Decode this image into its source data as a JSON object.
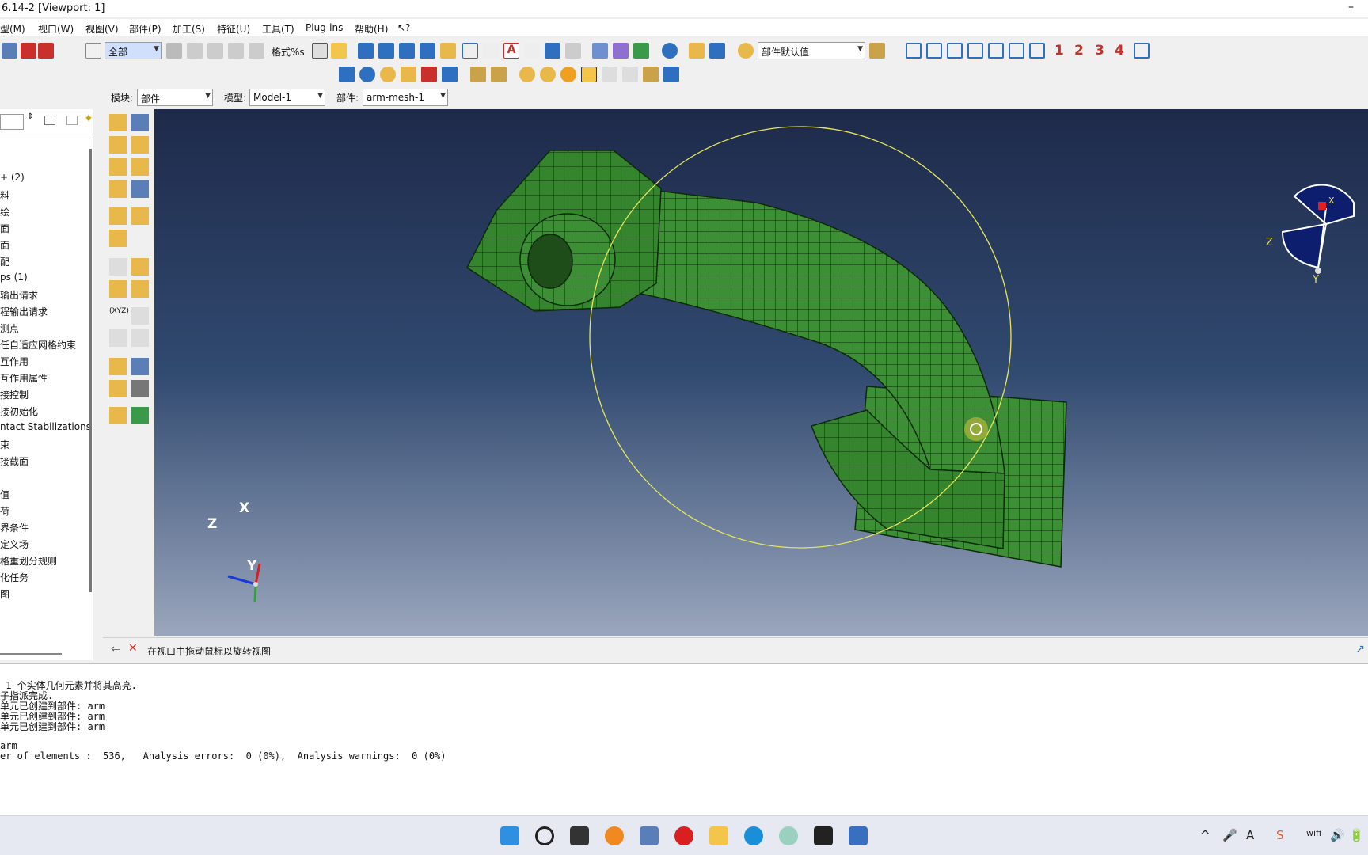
{
  "window": {
    "title": "6.14-2 [Viewport: 1]",
    "minimize": "–"
  },
  "menu": [
    "型(M)",
    "视口(W)",
    "视图(V)",
    "部件(P)",
    "加工(S)",
    "特征(U)",
    "工具(T)",
    "Plug-ins",
    "帮助(H)",
    "↖?"
  ],
  "toolbar": {
    "selection_filter": "全部",
    "format_text": "格式%s",
    "render_style": "部件默认值",
    "view_numbers": [
      "1",
      "2",
      "3",
      "4"
    ]
  },
  "context": {
    "module_label": "模块:",
    "module_value": "部件",
    "model_label": "模型:",
    "model_value": "Model-1",
    "part_label": "部件:",
    "part_value": "arm-mesh-1"
  },
  "tree_items": [
    "+ (2)",
    "料",
    "绘",
    "面",
    "面",
    "配",
    "ps (1)",
    "输出请求",
    "程输出请求",
    "测点",
    "任自适应网格约束",
    "互作用",
    "互作用属性",
    "接控制",
    "接初始化",
    "ntact Stabilizations",
    "束",
    "接截面",
    "",
    "值",
    "荷",
    "界条件",
    "定义场",
    "格重划分规则",
    "化任务",
    "图"
  ],
  "viewport": {
    "triad_main": {
      "x": "X",
      "y": "Y",
      "z": "Z"
    },
    "triad_mini": {
      "x": "X",
      "y": "Y",
      "z": "Z"
    },
    "colors": {
      "mesh_fill": "#3c8f34",
      "mesh_line": "#0d2a0a",
      "rotate_circle": "#e6e65a"
    }
  },
  "prompt": {
    "text": "在视口中拖动鼠标以旋转视图"
  },
  "messages": [
    " 1 个实体几何元素并将其高亮.",
    "子指派完成.",
    "单元已创建到部件: arm",
    "单元已创建到部件: arm",
    "单元已创建到部件: arm",
    "",
    "arm",
    "er of elements :  536,   Analysis errors:  0 (0%),  Analysis warnings:  0 (0%)"
  ],
  "taskbar": {
    "apps": [
      "start-icon",
      "search-icon",
      "task-view-icon",
      "everything-icon",
      "calculator-icon",
      "netease-music-icon",
      "file-explorer-icon",
      "edge-icon",
      "app-icon",
      "terminal-icon",
      "abaqus-icon"
    ],
    "tray": [
      "^",
      "🎤",
      "A",
      "S",
      "wifi",
      "🔊",
      "🔋"
    ]
  }
}
